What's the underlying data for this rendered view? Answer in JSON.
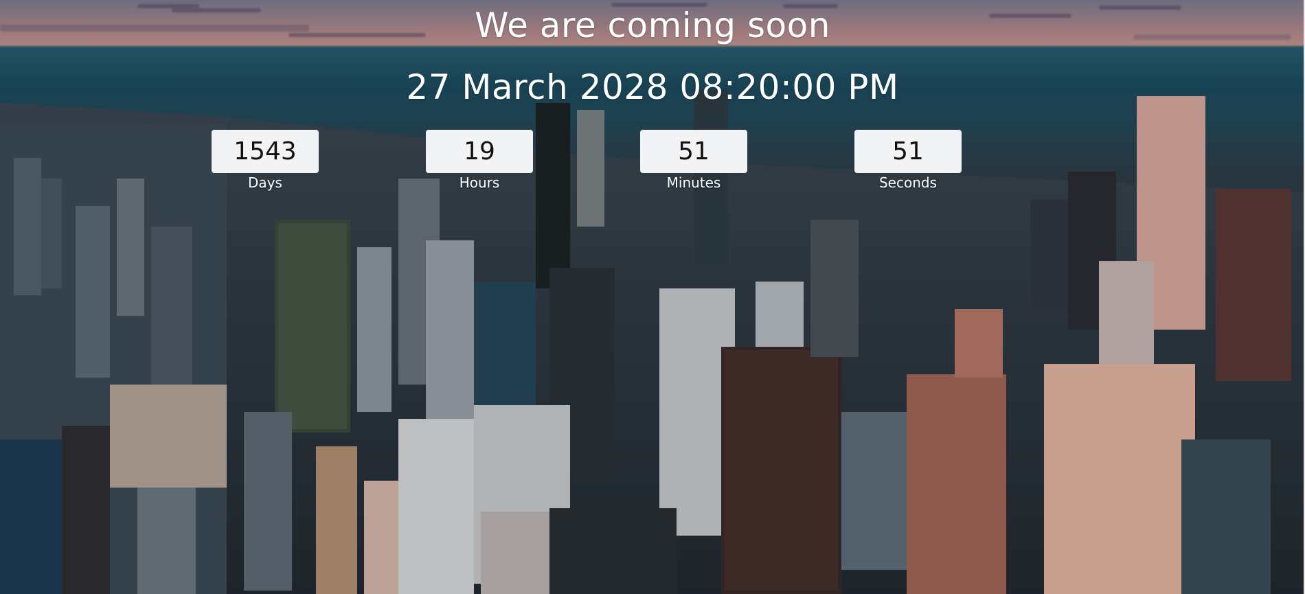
{
  "page": {
    "title": "We are coming soon",
    "launch_date": "27 March 2028 08:20:00 PM"
  },
  "countdown": {
    "days": {
      "value": "1543",
      "label": "Days"
    },
    "hours": {
      "value": "19",
      "label": "Hours"
    },
    "minutes": {
      "value": "51",
      "label": "Minutes"
    },
    "seconds": {
      "value": "51",
      "label": "Seconds"
    }
  },
  "background": {
    "description_icon": "city-skyline-photo",
    "colors": {
      "sky": "#b08a8e",
      "water": "#1b4d60",
      "city": "#2f3d48"
    }
  },
  "colors": {
    "box_background": "#f2f3f5",
    "box_text": "#111111",
    "label_text": "#ffffff",
    "title_text": "#ffffff"
  }
}
